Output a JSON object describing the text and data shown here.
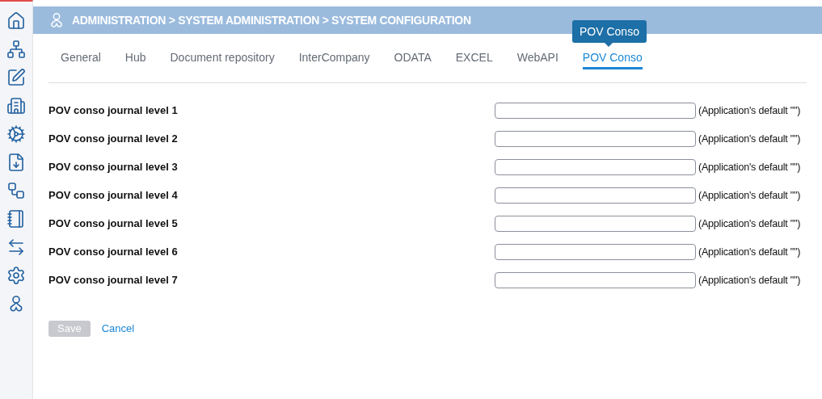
{
  "header": {
    "breadcrumb": "ADMINISTRATION > SYSTEM ADMINISTRATION > SYSTEM CONFIGURATION"
  },
  "tabs": [
    {
      "label": "General",
      "selected": false
    },
    {
      "label": "Hub",
      "selected": false
    },
    {
      "label": "Document repository",
      "selected": false
    },
    {
      "label": "InterCompany",
      "selected": false
    },
    {
      "label": "ODATA",
      "selected": false
    },
    {
      "label": "EXCEL",
      "selected": false
    },
    {
      "label": "WebAPI",
      "selected": false
    },
    {
      "label": "POV Conso",
      "selected": true
    }
  ],
  "tooltip": "POV Conso",
  "fields": [
    {
      "label": "POV conso journal level 1",
      "hint": "(Application's default \"\")"
    },
    {
      "label": "POV conso journal level 2",
      "hint": "(Application's default \"\")"
    },
    {
      "label": "POV conso journal level 3",
      "hint": "(Application's default \"\")"
    },
    {
      "label": "POV conso journal level 4",
      "hint": "(Application's default \"\")"
    },
    {
      "label": "POV conso journal level 5",
      "hint": "(Application's default \"\")"
    },
    {
      "label": "POV conso journal level 6",
      "hint": "(Application's default \"\")"
    },
    {
      "label": "POV conso journal level 7",
      "hint": "(Application's default \"\")"
    }
  ],
  "buttons": {
    "save": {
      "label": "Save",
      "disabled": true
    },
    "cancel": "Cancel"
  }
}
